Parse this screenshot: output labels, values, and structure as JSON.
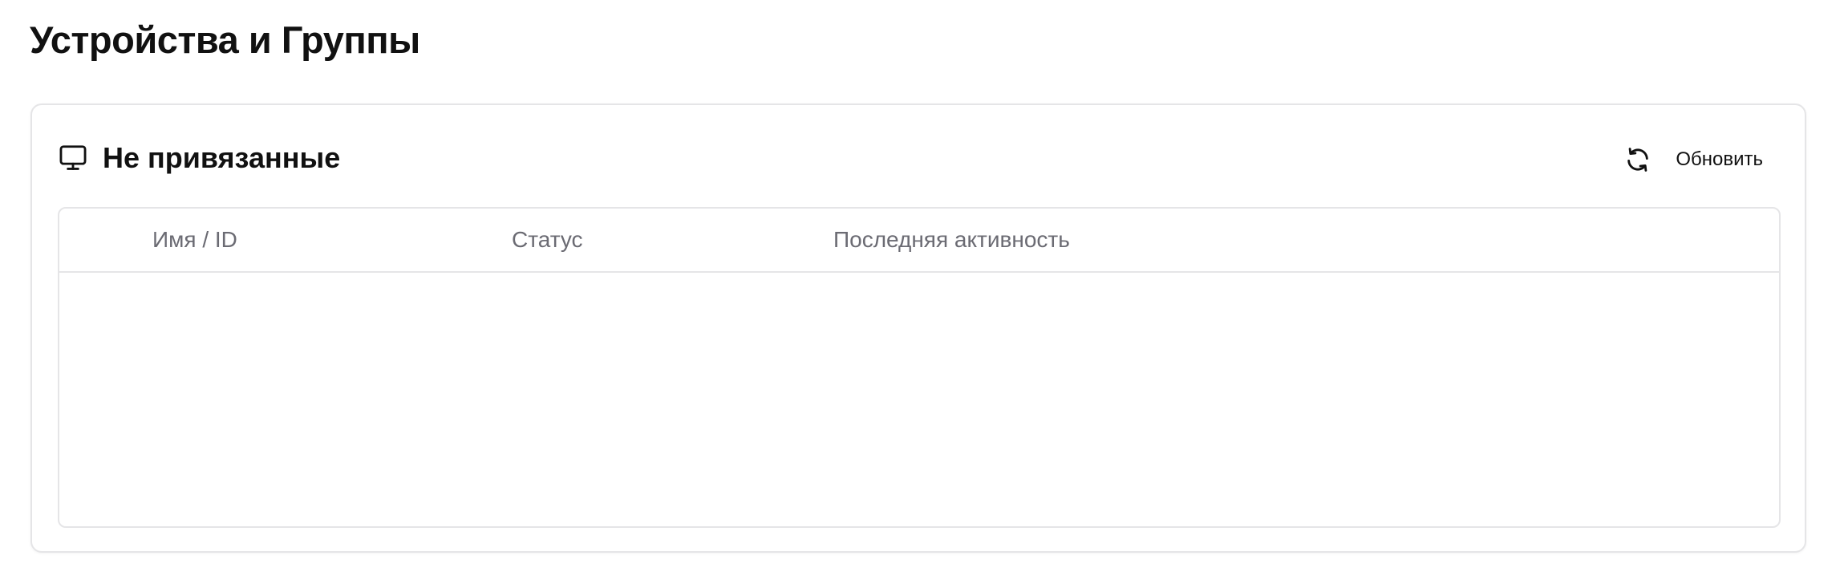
{
  "page": {
    "title": "Устройства и Группы"
  },
  "unbound_section": {
    "icon": "monitor-icon",
    "title": "Не привязанные",
    "refresh_button": {
      "icon": "refresh-icon",
      "label": "Обновить"
    },
    "table": {
      "columns": [
        "Имя / ID",
        "Статус",
        "Последняя активность"
      ],
      "rows": []
    }
  }
}
